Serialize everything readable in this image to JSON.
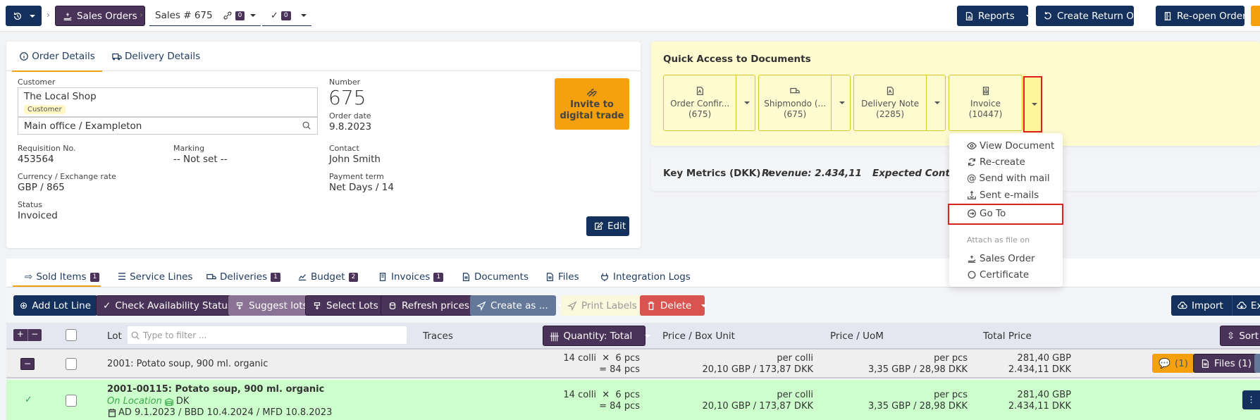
{
  "topbar": {
    "history_icon": "history-icon",
    "breadcrumb_sales_orders": "Sales Orders",
    "current": "Sales # 675",
    "links_count": "0",
    "checks_count": "0",
    "reports": "Reports",
    "create_return": "Create Return Order",
    "reopen": "Re-open Order"
  },
  "order": {
    "tabs": [
      "Order Details",
      "Delivery Details"
    ],
    "customer_label": "Customer",
    "customer_name": "The Local Shop",
    "customer_tag": "Customer",
    "address": "Main office / Exampleton",
    "requisition_label": "Requisition No.",
    "requisition": "453564",
    "marking_label": "Marking",
    "marking": "-- Not set --",
    "currency_label": "Currency / Exchange rate",
    "currency": "GBP / 865",
    "status_label": "Status",
    "status": "Invoiced",
    "number_label": "Number",
    "number": "675",
    "order_date_label": "Order date",
    "order_date": "9.8.2023",
    "contact_label": "Contact",
    "contact": "John Smith",
    "payment_label": "Payment term",
    "payment": "Net Days / 14",
    "invite_l1": "Invite to",
    "invite_l2": "digital trade",
    "edit": "Edit"
  },
  "quick_access": {
    "title": "Quick Access to Documents",
    "docs": [
      {
        "name": "Order Confir...",
        "num": "(675)",
        "icon": "pdf-icon"
      },
      {
        "name": "Shipmondo (...",
        "num": "(675)",
        "icon": "truck-icon"
      },
      {
        "name": "Delivery Note",
        "num": "(2285)",
        "icon": "pdf-icon"
      },
      {
        "name": "Invoice",
        "num": "(10447)",
        "icon": "invoice-icon"
      }
    ]
  },
  "key_metrics": {
    "label": "Key Metrics (DKK)",
    "revenue": "Revenue: 2.434,11",
    "expected": "Expected Contribution"
  },
  "doc_menu": {
    "items": [
      "View Document",
      "Re-create",
      "Send with mail",
      "Sent e-mails",
      "Go To"
    ],
    "section": "Attach as file on",
    "attach": [
      "Sales Order",
      "Certificate"
    ]
  },
  "lines": {
    "tabs": [
      {
        "label": "Sold Items",
        "badge": "1"
      },
      {
        "label": "Service Lines",
        "badge": ""
      },
      {
        "label": "Deliveries",
        "badge": "1"
      },
      {
        "label": "Budget",
        "badge": "2"
      },
      {
        "label": "Invoices",
        "badge": "1"
      },
      {
        "label": "Documents",
        "badge": ""
      },
      {
        "label": "Files",
        "badge": ""
      },
      {
        "label": "Integration Logs",
        "badge": ""
      }
    ],
    "toolbar": {
      "add_lot": "Add Lot Line",
      "check": "Check Availability Status",
      "suggest": "Suggest lots",
      "select": "Select Lots",
      "refresh": "Refresh prices",
      "create_as": "Create as ...",
      "print": "Print Labels",
      "delete": "Delete",
      "import": "Import",
      "export": "Exp"
    },
    "headers": {
      "lot": "Lot",
      "filter_placeholder": "Type to filter ...",
      "traces": "Traces",
      "quantity": "Quantity: Total",
      "price_box": "Price / Box Unit",
      "price_uom": "Price / UoM",
      "total": "Total Price",
      "sort": "Sort"
    },
    "rows": [
      {
        "title": "2001: Potato soup, 900 ml. organic",
        "qty1": "14 colli  ✕  6 pcs",
        "qty2": "= 84 pcs",
        "pb1": "per colli",
        "pb2": "20,10 GBP / 173,87 DKK",
        "pu1": "per pcs",
        "pu2": "3,35 GBP / 28,98 DKK",
        "t1": "281,40 GBP",
        "t2": "2.434,11 DKK",
        "comments": "(1)",
        "files": "Files (1)"
      },
      {
        "title": "2001-00115: Potato soup, 900 ml. organic",
        "location": "On Location",
        "country": "DK",
        "dates": "AD 9.1.2023 / BBD 10.4.2024 / MFD 10.8.2023",
        "qty1": "14 colli  ✕  6 pcs",
        "qty2": "= 84 pcs",
        "pb1": "per colli",
        "pb2": "20,10 GBP / 173,87 DKK",
        "pu1": "per pcs",
        "pu2": "3,35 GBP / 28,98 DKK",
        "t1": "281,40 GBP",
        "t2": "2.434,11 DKK"
      }
    ]
  },
  "colors": {
    "navy": "#13315c",
    "plum": "#4a3358",
    "orange": "#f5a00f",
    "quick_access_bg": "#fffbd0",
    "highlight_red": "#e0201c",
    "row_green": "#ccffcc"
  }
}
